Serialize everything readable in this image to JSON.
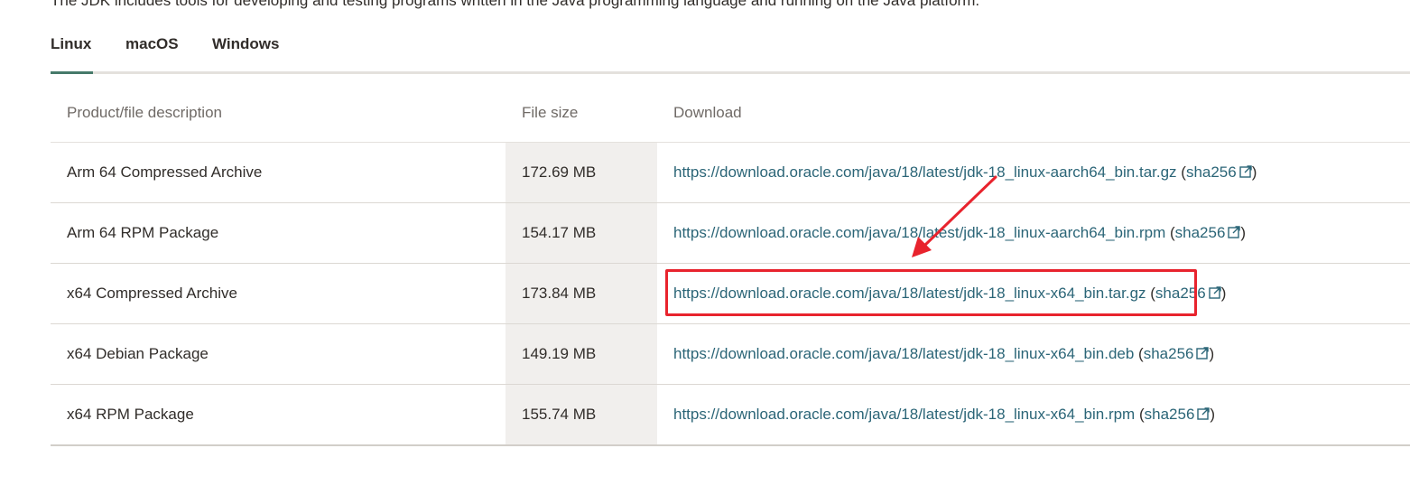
{
  "intro_text": "The JDK includes tools for developing and testing programs written in the Java programming language and running on the Java platform.",
  "tabs": [
    {
      "label": "Linux",
      "active": true
    },
    {
      "label": "macOS",
      "active": false
    },
    {
      "label": "Windows",
      "active": false
    }
  ],
  "table": {
    "headers": {
      "description": "Product/file description",
      "size": "File size",
      "download": "Download"
    },
    "rows": [
      {
        "description": "Arm 64 Compressed Archive",
        "size": "172.69 MB",
        "url": "https://download.oracle.com/java/18/latest/jdk-18_linux-aarch64_bin.tar.gz",
        "checksum_label": "sha256"
      },
      {
        "description": "Arm 64 RPM Package",
        "size": "154.17 MB",
        "url": "https://download.oracle.com/java/18/latest/jdk-18_linux-aarch64_bin.rpm",
        "checksum_label": "sha256"
      },
      {
        "description": "x64 Compressed Archive",
        "size": "173.84 MB",
        "url": "https://download.oracle.com/java/18/latest/jdk-18_linux-x64_bin.tar.gz",
        "checksum_label": "sha256"
      },
      {
        "description": "x64 Debian Package",
        "size": "149.19 MB",
        "url": "https://download.oracle.com/java/18/latest/jdk-18_linux-x64_bin.deb",
        "checksum_label": "sha256"
      },
      {
        "description": "x64 RPM Package",
        "size": "155.74 MB",
        "url": "https://download.oracle.com/java/18/latest/jdk-18_linux-x64_bin.rpm",
        "checksum_label": "sha256"
      }
    ]
  },
  "icons": {
    "checksum_link": "external-link-icon"
  },
  "annotation": {
    "highlighted_row": 2,
    "color": "#e8232d"
  },
  "colors": {
    "link": "#2b6577",
    "active_tab_underline": "#467a6a",
    "size_column_bg": "#f1efed"
  }
}
